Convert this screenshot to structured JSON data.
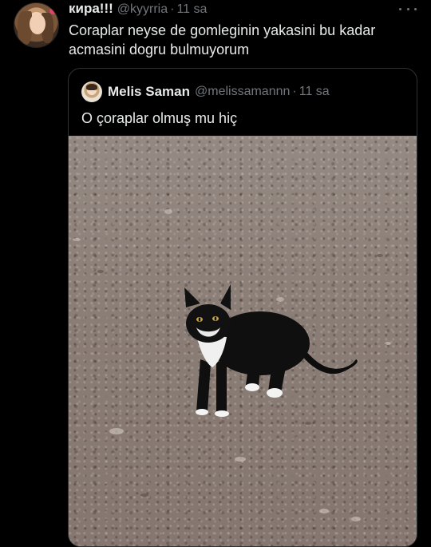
{
  "tweet": {
    "display_name": "кира!!!",
    "handle": "@kyyrria",
    "separator": "·",
    "time": "11 sa",
    "text": "Coraplar neyse de gomleginin yakasini bu kadar acmasini dogru bulmuyorum",
    "more_icon": "more-horizontal-icon"
  },
  "quote": {
    "display_name": "Melis Saman",
    "handle": "@melissamannn",
    "separator": "·",
    "time": "11 sa",
    "text": "O çoraplar olmuş mu hiç",
    "media": "photo-black-and-white-cat"
  },
  "colors": {
    "background": "#000000",
    "text_primary": "#e7e9ea",
    "text_secondary": "#71767b",
    "border": "#2f3336"
  }
}
